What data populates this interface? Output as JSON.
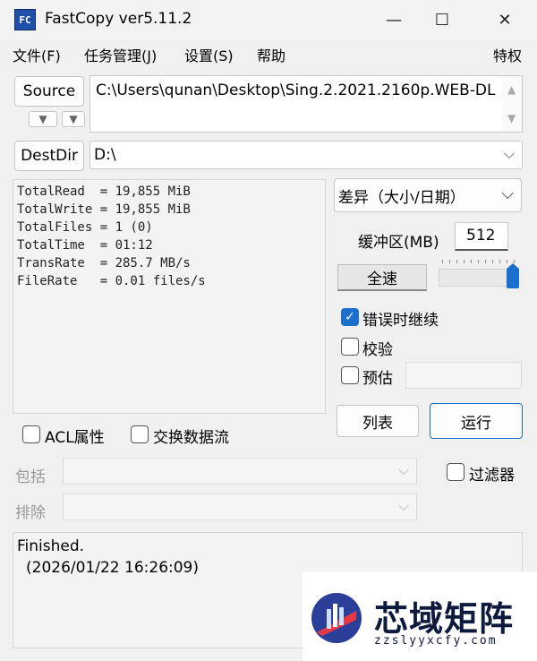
{
  "window": {
    "app_icon_text": "FC",
    "title": "FastCopy ver5.11.2",
    "minimize_glyph": "—",
    "maximize_glyph": "☐",
    "close_glyph": "✕"
  },
  "menu": {
    "items": [
      "文件(F)",
      "任务管理(J)",
      "设置(S)",
      "帮助"
    ],
    "right_item": "特权"
  },
  "source": {
    "button_label": "Source",
    "path": "C:\\Users\\qunan\\Desktop\\Sing.2.2021.2160p.WEB-DL"
  },
  "dest": {
    "button_label": "DestDir",
    "path": "D:\\"
  },
  "log": {
    "lines": [
      "TotalRead  = 19,855 MiB",
      "TotalWrite = 19,855 MiB",
      "TotalFiles = 1 (0)",
      "TotalTime  = 01:12",
      "TransRate  = 285.7 MB/s",
      "FileRate   = 0.01 files/s"
    ]
  },
  "options": {
    "mode_value": "差异（大小/日期）",
    "buffer_label": "缓冲区(MB)",
    "buffer_value": "512",
    "speed_label": "全速",
    "speed_level": 1.0,
    "continue_on_error_label": "错误时继续",
    "continue_on_error_checked": true,
    "verify_label": "校验",
    "verify_checked": false,
    "estimate_label": "预估",
    "estimate_checked": false,
    "list_button": "列表",
    "run_button": "运行"
  },
  "filters": {
    "acl_label": "ACL属性",
    "ads_label": "交换数据流",
    "include_label": "包括",
    "exclude_label": "排除",
    "filter_label": "过滤器"
  },
  "status": {
    "line1": "Finished.",
    "line2": "(2026/01/22 16:26:09)"
  },
  "watermark": {
    "title": "芯域矩阵",
    "subtitle": "zzslyyxcfy.com"
  },
  "colors": {
    "accent": "#1a6fcf",
    "slider": "#1a6fcf"
  }
}
